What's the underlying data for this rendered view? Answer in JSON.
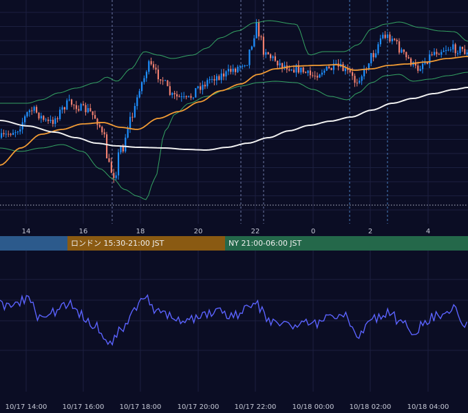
{
  "chart_data": [
    {
      "type": "candlestick",
      "title": "",
      "x_ticks": [
        "14",
        "16",
        "18",
        "20",
        "22",
        "0",
        "2",
        "4"
      ],
      "y_range": [
        0.0,
        1.0
      ],
      "series": [
        {
          "name": "",
          "type": "candlestick",
          "color_up": "#1e90ff",
          "color_down": "#f08070"
        },
        {
          "name": "",
          "type": "line",
          "color": "#f39c34"
        },
        {
          "name": "",
          "type": "line",
          "color": "#f2f2f2"
        },
        {
          "name": "",
          "type": "band",
          "color": "#3cbf6e"
        }
      ]
    },
    {
      "type": "line",
      "title": "",
      "x_ticks": [
        "10/17 14:00",
        "10/17 16:00",
        "10/17 18:00",
        "10/17 20:00",
        "10/17 22:00",
        "10/18 00:00",
        "10/18 02:00",
        "10/18 04:00"
      ],
      "series": [
        {
          "name": "",
          "color": "#5b63ff"
        }
      ]
    }
  ],
  "sessions": [
    {
      "label": "",
      "color": "#2c5a8c"
    },
    {
      "label": "ロンドン 15:30-21:00 JST",
      "color": "#8a5a12"
    },
    {
      "label": "NY 21:00-06:00 JST",
      "color": "#24684a"
    }
  ],
  "colors": {
    "background": "#0b0d24",
    "grid": "#1c2040",
    "candle_up": "#1e90ff",
    "candle_down": "#f08070",
    "ma_short": "#f39c34",
    "ma_long": "#f2f2f2",
    "bollinger": "#3cbf6e",
    "oscillator": "#5b63ff",
    "dotted_level": "#9aa0b0"
  }
}
